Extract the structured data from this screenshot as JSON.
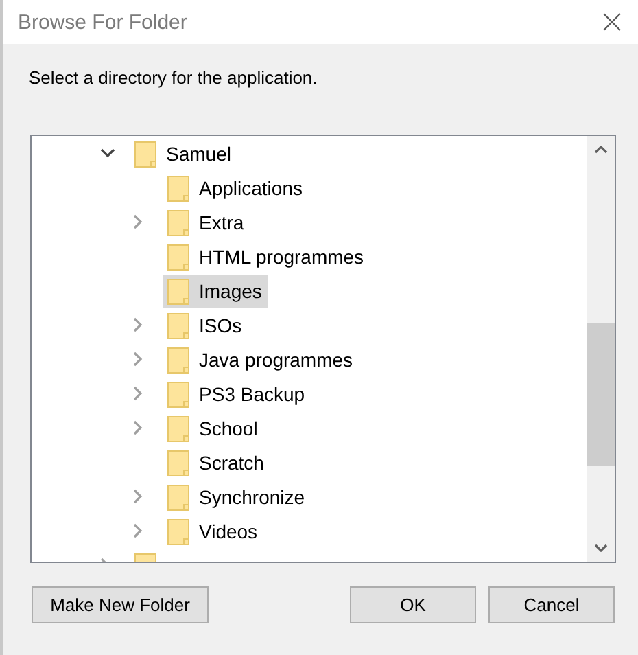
{
  "window": {
    "title": "Browse For Folder"
  },
  "instruction": "Select a directory for the application.",
  "tree": [
    {
      "label": "Samuel",
      "kind": "branch",
      "expanded": true,
      "selected": false,
      "children": [
        {
          "label": "Applications",
          "kind": "leaf",
          "expanded": false,
          "selected": false
        },
        {
          "label": "Extra",
          "kind": "branch",
          "expanded": false,
          "selected": false
        },
        {
          "label": "HTML programmes",
          "kind": "leaf",
          "expanded": false,
          "selected": false
        },
        {
          "label": "Images",
          "kind": "leaf",
          "expanded": false,
          "selected": true
        },
        {
          "label": "ISOs",
          "kind": "branch",
          "expanded": false,
          "selected": false
        },
        {
          "label": "Java programmes",
          "kind": "branch",
          "expanded": false,
          "selected": false
        },
        {
          "label": "PS3 Backup",
          "kind": "branch",
          "expanded": false,
          "selected": false
        },
        {
          "label": "School",
          "kind": "branch",
          "expanded": false,
          "selected": false
        },
        {
          "label": "Scratch",
          "kind": "leaf",
          "expanded": false,
          "selected": false
        },
        {
          "label": "Synchronize",
          "kind": "branch",
          "expanded": false,
          "selected": false
        },
        {
          "label": "Videos",
          "kind": "branch",
          "expanded": false,
          "selected": false
        }
      ]
    },
    {
      "kind": "branch",
      "expanded": false,
      "selected": false
    }
  ],
  "buttons": [
    {
      "label": "Make New Folder"
    },
    {
      "label": "OK"
    },
    {
      "label": "Cancel"
    }
  ]
}
